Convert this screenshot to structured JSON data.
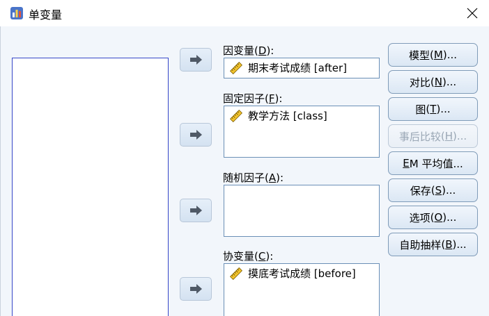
{
  "window": {
    "title": "单变量",
    "app_icon": "spss-app-icon",
    "close_icon": "close-icon"
  },
  "fields": {
    "dependent": {
      "label": "因变量",
      "mnemonic": "D",
      "suffix": ":",
      "items": [
        "期末考试成绩 [after]"
      ]
    },
    "fixed": {
      "label": "固定因子",
      "mnemonic": "F",
      "suffix": ":",
      "items": [
        "教学方法 [class]"
      ]
    },
    "random": {
      "label": "随机因子",
      "mnemonic": "A",
      "suffix": ":",
      "items": []
    },
    "covariate": {
      "label": "协变量",
      "mnemonic": "C",
      "suffix": ":",
      "items": [
        "摸底考试成绩 [before]"
      ]
    }
  },
  "buttons": {
    "model": {
      "label": "模型",
      "mnemonic": "M",
      "suffix": "..."
    },
    "contrast": {
      "label": "对比",
      "mnemonic": "N",
      "suffix": "..."
    },
    "plots": {
      "label": "图",
      "mnemonic": "T",
      "suffix": "..."
    },
    "posthoc": {
      "label": "事后比较",
      "mnemonic": "H",
      "suffix": "...",
      "disabled": true
    },
    "em_prefix": "E",
    "em": {
      "label": "M 平均值...",
      "mnemonic": "E"
    },
    "save": {
      "label": "保存",
      "mnemonic": "S",
      "suffix": "..."
    },
    "options": {
      "label": "选项",
      "mnemonic": "O",
      "suffix": "..."
    },
    "bootstrap": {
      "label": "自助抽样",
      "mnemonic": "B",
      "suffix": "..."
    }
  },
  "icons": {
    "move": "arrow-right-icon",
    "scale_variable": "ruler-icon"
  },
  "colors": {
    "accent_border": "#3546c8",
    "body_bg": "#f2f6fb"
  }
}
